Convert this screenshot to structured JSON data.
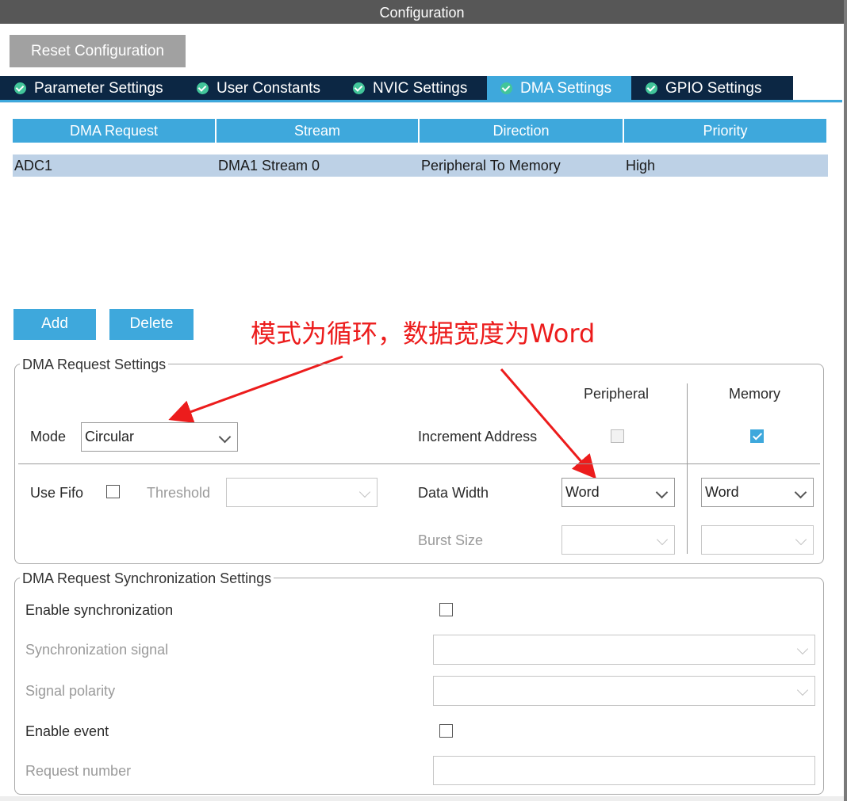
{
  "window": {
    "title": "Configuration"
  },
  "toolbar": {
    "reset_label": "Reset Configuration"
  },
  "tabs": [
    {
      "label": "Parameter Settings",
      "active": false
    },
    {
      "label": "User Constants",
      "active": false
    },
    {
      "label": "NVIC Settings",
      "active": false
    },
    {
      "label": "DMA Settings",
      "active": true
    },
    {
      "label": "GPIO Settings",
      "active": false
    }
  ],
  "dma_table": {
    "headers": [
      "DMA Request",
      "Stream",
      "Direction",
      "Priority"
    ],
    "rows": [
      [
        "ADC1",
        "DMA1 Stream 0",
        "Peripheral To Memory",
        "High"
      ]
    ]
  },
  "actions": {
    "add_label": "Add",
    "delete_label": "Delete"
  },
  "annotation": {
    "text": "模式为循环，数据宽度为Word",
    "color": "#ec1c1c"
  },
  "request_settings": {
    "legend": "DMA Request Settings",
    "peripheral_header": "Peripheral",
    "memory_header": "Memory",
    "mode_label": "Mode",
    "mode_value": "Circular",
    "increment_label": "Increment Address",
    "increment_peripheral": false,
    "increment_memory": true,
    "use_fifo_label": "Use Fifo",
    "use_fifo": false,
    "threshold_label": "Threshold",
    "threshold_value": "",
    "data_width_label": "Data Width",
    "data_width_peripheral": "Word",
    "data_width_memory": "Word",
    "burst_size_label": "Burst Size",
    "burst_peripheral": "",
    "burst_memory": ""
  },
  "sync_settings": {
    "legend": "DMA Request Synchronization Settings",
    "enable_sync_label": "Enable synchronization",
    "enable_sync": false,
    "sync_signal_label": "Synchronization signal",
    "sync_signal_value": "",
    "signal_polarity_label": "Signal polarity",
    "signal_polarity_value": "",
    "enable_event_label": "Enable event",
    "enable_event": false,
    "request_number_label": "Request number",
    "request_number_value": ""
  },
  "colors": {
    "accent": "#3ea8dc",
    "tab_dark": "#0c2744",
    "title_bar": "#575757",
    "row_selected": "#bdd1e6",
    "check_green": "#42c59a"
  }
}
